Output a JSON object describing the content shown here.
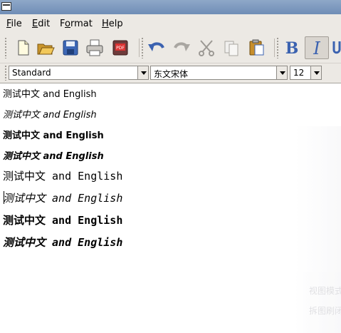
{
  "menubar": {
    "items": [
      "File",
      "Edit",
      "Format",
      "Help"
    ],
    "mnemonics": [
      "F",
      "E",
      "o",
      "H"
    ]
  },
  "toolbar": {
    "buttons": [
      "new-document",
      "open",
      "save",
      "print",
      "export-pdf",
      "undo",
      "redo",
      "cut",
      "copy",
      "paste",
      "bold",
      "italic",
      "underline"
    ],
    "pressed": "italic",
    "bold_glyph": "B",
    "italic_glyph": "I",
    "pdf_badge": "PDF"
  },
  "format": {
    "style": "Standard",
    "font": "东文宋体",
    "size": "12"
  },
  "document": {
    "lines": [
      "测试中文 and English",
      "测试中文 and English",
      "测试中文 and English",
      "测试中文 and English",
      "测试中文 and English",
      "测试中文 and English",
      "测试中文 and English",
      "测试中文 and English"
    ]
  },
  "background_ghost": {
    "items": [
      "视图模式",
      "拆图刷闭"
    ]
  },
  "colors": {
    "window_bg": "#ece9e4",
    "titlebar": "#7f99bf",
    "doc_bg": "#ffffff",
    "accent_blue": "#3b62b0"
  }
}
